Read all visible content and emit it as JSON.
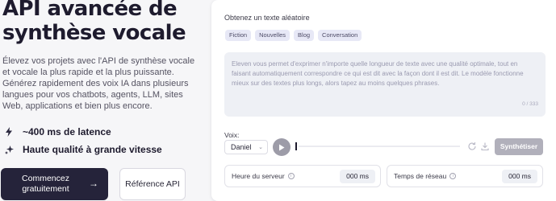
{
  "hero": {
    "title": "API avancée de synthèse vocale",
    "description": "Élevez vos projets avec l'API de synthèse vocale et vocale la plus rapide et la plus puissante. Générez rapidement des voix IA dans plusieurs langues pour vos chatbots, agents, LLM, sites Web, applications et bien plus encore.",
    "features": [
      {
        "icon": "lightning-icon",
        "label": "~400 ms de latence"
      },
      {
        "icon": "sparkles-icon",
        "label": "Haute qualité à grande vitesse"
      }
    ],
    "cta_primary": "Commencez gratuitement",
    "cta_secondary": "Référence API"
  },
  "demo": {
    "random_text_label": "Obtenez un texte aléatoire",
    "chips": [
      "Fiction",
      "Nouvelles",
      "Blog",
      "Conversation"
    ],
    "textarea_placeholder": "Eleven vous permet d'exprimer n'importe quelle longueur de texte avec une qualité optimale, tout en faisant automatiquement correspondre ce qui est dit avec la façon dont il est dit. Le modèle fonctionne mieux sur des textes plus longs, alors tapez au moins quelques phrases.",
    "char_counter": "0 / 333",
    "voice_label": "Voix:",
    "voice_value": "Daniel",
    "synthesize_label": "Synthétiser",
    "metrics": [
      {
        "label": "Heure du serveur",
        "value": "000 ms"
      },
      {
        "label": "Temps de réseau",
        "value": "000 ms"
      }
    ]
  },
  "colors": {
    "primary_button": "#25233a",
    "chip_bg": "#e7e8f6",
    "synth_button": "#b1b0bb",
    "page_bg": "#f6f6f8"
  }
}
